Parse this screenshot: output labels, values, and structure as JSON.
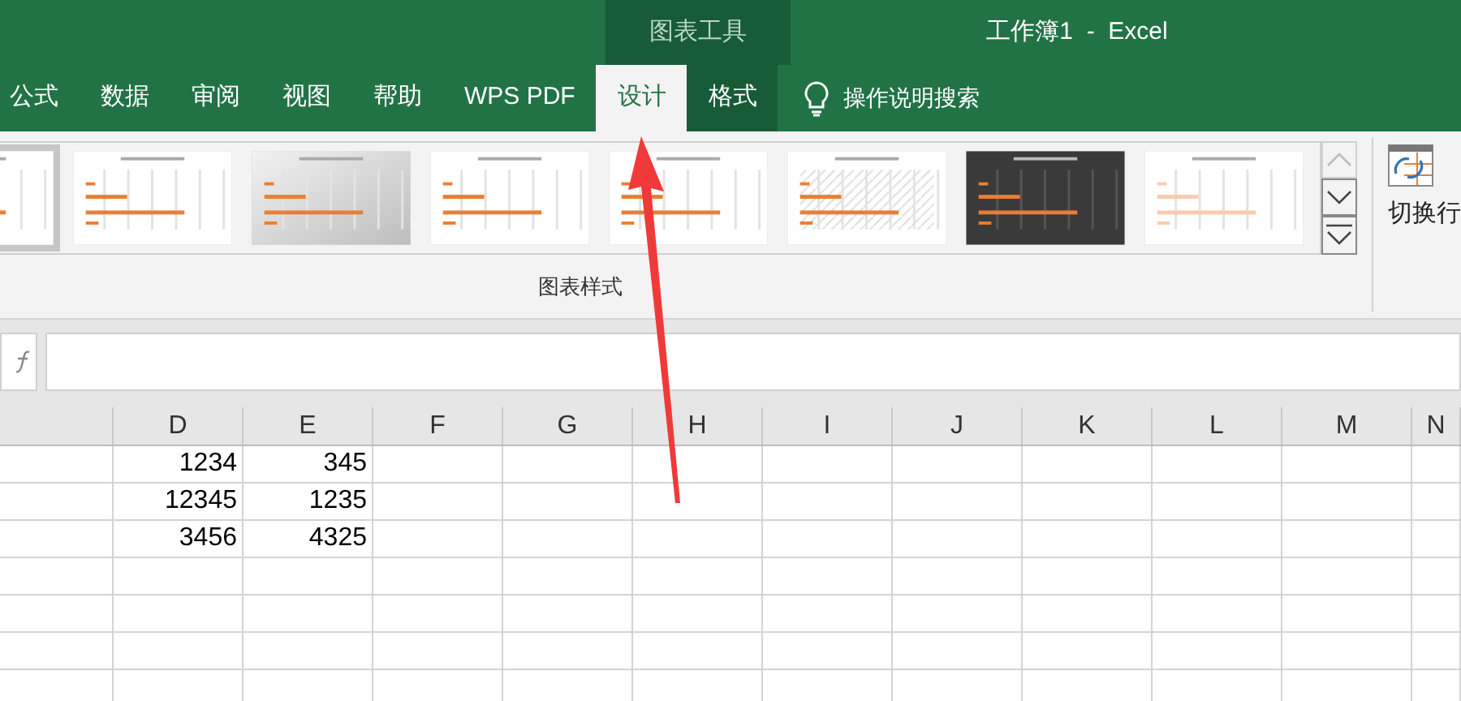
{
  "title_bar": {
    "context_group": "图表工具",
    "title": "工作簿1  -  Excel"
  },
  "tabs": [
    {
      "label": "公式",
      "selected": false,
      "contextual": false
    },
    {
      "label": "数据",
      "selected": false,
      "contextual": false
    },
    {
      "label": "审阅",
      "selected": false,
      "contextual": false
    },
    {
      "label": "视图",
      "selected": false,
      "contextual": false
    },
    {
      "label": "帮助",
      "selected": false,
      "contextual": false
    },
    {
      "label": "WPS PDF",
      "selected": false,
      "contextual": false
    },
    {
      "label": "设计",
      "selected": true,
      "contextual": true
    },
    {
      "label": "格式",
      "selected": false,
      "contextual": true
    }
  ],
  "search": {
    "placeholder": "操作说明搜索"
  },
  "ribbon": {
    "styles": [
      {
        "kind": "plain",
        "selected": true
      },
      {
        "kind": "plain",
        "selected": false
      },
      {
        "kind": "gradient",
        "selected": false
      },
      {
        "kind": "plain",
        "selected": false
      },
      {
        "kind": "plain",
        "selected": false
      },
      {
        "kind": "hatched",
        "selected": false
      },
      {
        "kind": "dark",
        "selected": false
      },
      {
        "kind": "faint",
        "selected": false
      }
    ],
    "group_label": "图表样式",
    "switch_button": "切换行"
  },
  "sheet": {
    "columns": [
      "D",
      "E",
      "F",
      "G",
      "H",
      "I",
      "J",
      "K",
      "L",
      "M",
      "N"
    ],
    "rows": [
      [
        "1234",
        "345"
      ],
      [
        "12345",
        "1235"
      ],
      [
        "3456",
        "4325"
      ],
      [],
      [],
      [],
      []
    ]
  }
}
